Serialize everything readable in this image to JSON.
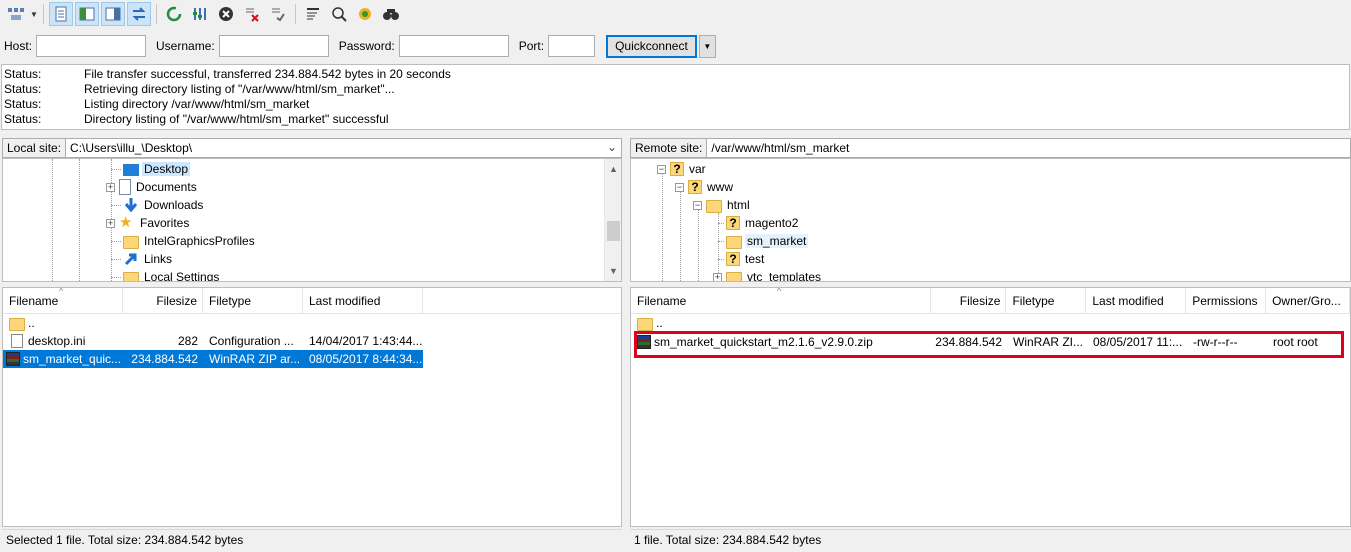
{
  "quickconnect": {
    "host_label": "Host:",
    "username_label": "Username:",
    "password_label": "Password:",
    "port_label": "Port:",
    "host_value": "",
    "username_value": "",
    "password_value": "",
    "port_value": "",
    "button_label": "Quickconnect"
  },
  "log": [
    {
      "key": "Status:",
      "msg": "File transfer successful, transferred 234.884.542 bytes in 20 seconds"
    },
    {
      "key": "Status:",
      "msg": "Retrieving directory listing of \"/var/www/html/sm_market\"..."
    },
    {
      "key": "Status:",
      "msg": "Listing directory /var/www/html/sm_market"
    },
    {
      "key": "Status:",
      "msg": "Directory listing of \"/var/www/html/sm_market\" successful"
    }
  ],
  "local": {
    "site_label": "Local site:",
    "path": "C:\\Users\\illu_\\Desktop\\",
    "tree": [
      "Desktop",
      "Documents",
      "Downloads",
      "Favorites",
      "IntelGraphicsProfiles",
      "Links",
      "Local Settings"
    ],
    "columns": [
      "Filename",
      "Filesize",
      "Filetype",
      "Last modified"
    ],
    "rows": [
      {
        "name": "..",
        "size": "",
        "type": "",
        "modified": ""
      },
      {
        "name": "desktop.ini",
        "size": "282",
        "type": "Configuration ...",
        "modified": "14/04/2017 1:43:44..."
      },
      {
        "name": "sm_market_quic...",
        "size": "234.884.542",
        "type": "WinRAR ZIP ar...",
        "modified": "08/05/2017 8:44:34..."
      }
    ],
    "status": "Selected 1 file. Total size: 234.884.542 bytes"
  },
  "remote": {
    "site_label": "Remote site:",
    "path": "/var/www/html/sm_market",
    "tree": [
      "var",
      "www",
      "html",
      "magento2",
      "sm_market",
      "test",
      "vtc_templates"
    ],
    "columns": [
      "Filename",
      "Filesize",
      "Filetype",
      "Last modified",
      "Permissions",
      "Owner/Gro..."
    ],
    "rows": [
      {
        "name": "..",
        "size": "",
        "type": "",
        "modified": "",
        "perm": "",
        "owner": ""
      },
      {
        "name": "sm_market_quickstart_m2.1.6_v2.9.0.zip",
        "size": "234.884.542",
        "type": "WinRAR ZI...",
        "modified": "08/05/2017 11:...",
        "perm": "-rw-r--r--",
        "owner": "root root"
      }
    ],
    "status": "1 file. Total size: 234.884.542 bytes"
  },
  "colors": {
    "selection": "#0078d7",
    "highlight_box": "#e0001b"
  }
}
